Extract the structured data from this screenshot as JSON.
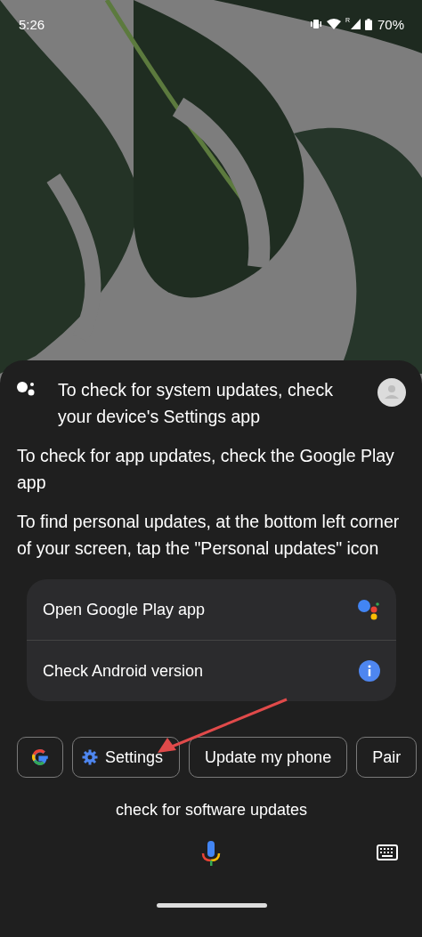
{
  "status_bar": {
    "time": "5:26",
    "roaming": "R",
    "battery": "70%"
  },
  "reply": {
    "lead": "To check for system updates, check your device's Settings app",
    "paragraphs": [
      "To check for app updates, check the Google Play app",
      "To find personal updates, at the bottom left corner of your screen, tap the \"Personal updates\" icon"
    ]
  },
  "actions": [
    {
      "label": "Open Google Play app",
      "kind": "assistant"
    },
    {
      "label": "Check Android version",
      "kind": "info"
    }
  ],
  "chips": [
    {
      "kind": "google"
    },
    {
      "kind": "settings",
      "label": "Settings"
    },
    {
      "kind": "text",
      "label": "Update my phone"
    },
    {
      "kind": "text",
      "label": "Pair"
    }
  ],
  "query": "check for software updates"
}
